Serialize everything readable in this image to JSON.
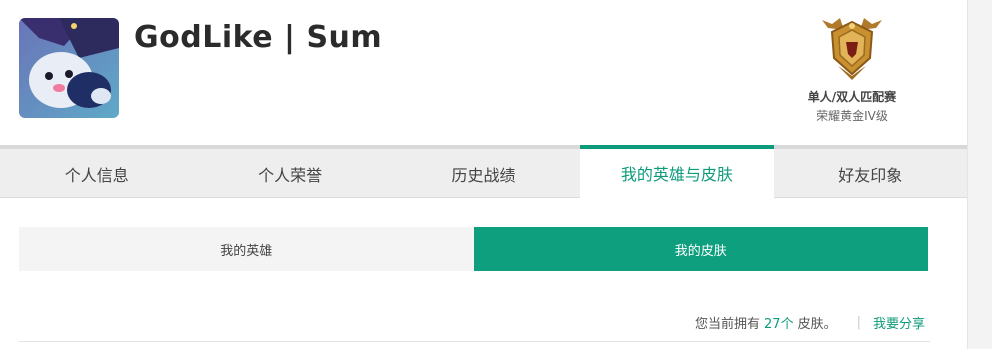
{
  "profile": {
    "name": "GodLike | Sum",
    "avatar_icon": "poro-avatar"
  },
  "rank": {
    "emblem_icon": "gold-rank-emblem-icon",
    "queue": "单人/双人匹配赛",
    "tier": "荣耀黄金IV级"
  },
  "tabs": [
    {
      "label": "个人信息",
      "active": false
    },
    {
      "label": "个人荣誉",
      "active": false
    },
    {
      "label": "历史战绩",
      "active": false
    },
    {
      "label": "我的英雄与皮肤",
      "active": true
    },
    {
      "label": "好友印象",
      "active": false
    }
  ],
  "subtabs": [
    {
      "label": "我的英雄",
      "active": false
    },
    {
      "label": "我的皮肤",
      "active": true
    }
  ],
  "summary": {
    "prefix": "您当前拥有",
    "count": "27个",
    "suffix": "皮肤。",
    "separator": "|",
    "share_label": "我要分享"
  },
  "colors": {
    "accent": "#0e9f7f",
    "tab_bar": "#eeeeee",
    "gold": "#c8902e"
  }
}
